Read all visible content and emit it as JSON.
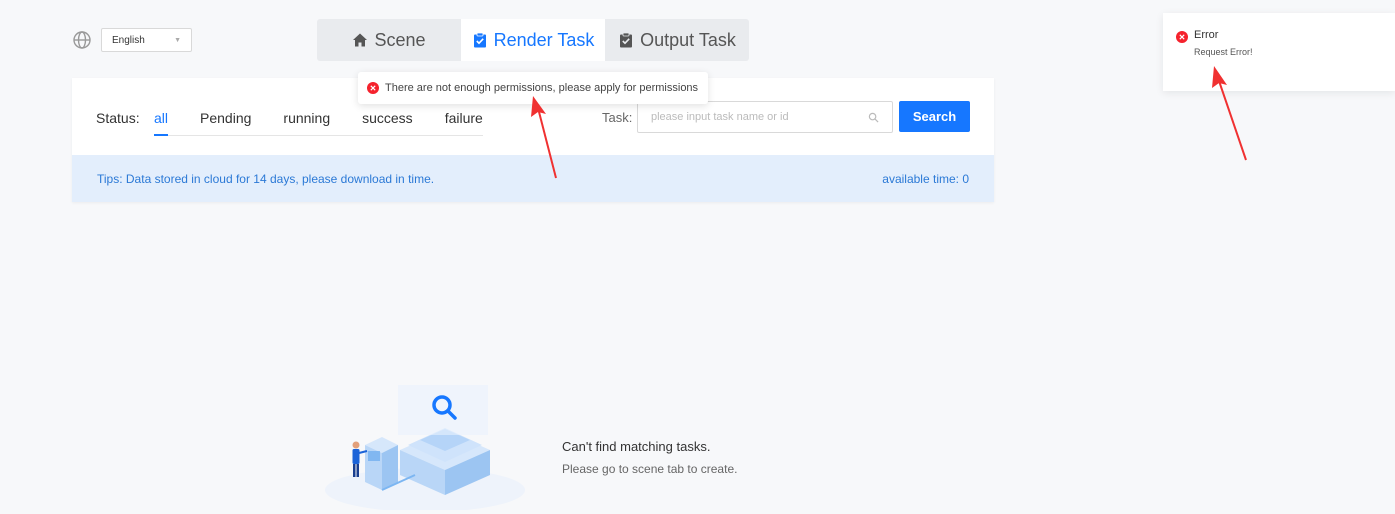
{
  "language": {
    "selected": "English"
  },
  "tabs": [
    {
      "label": "Scene",
      "icon": "home-icon"
    },
    {
      "label": "Render Task",
      "icon": "clipboard-check-icon"
    },
    {
      "label": "Output Task",
      "icon": "clipboard-icon"
    }
  ],
  "filter": {
    "status_label": "Status:",
    "statuses": [
      "all",
      "Pending",
      "running",
      "success",
      "failure"
    ],
    "active_status": "all",
    "task_label": "Task:",
    "task_placeholder": "please input task name or id",
    "search_label": "Search"
  },
  "tips": {
    "text": "Tips: Data stored in cloud for 14 days, please download in time.",
    "available_time": "available time: 0"
  },
  "permission_message": "There are not enough permissions, please apply for permissions",
  "notification": {
    "title": "Error",
    "description": "Request Error!"
  },
  "empty_state": {
    "title": "Can't find matching tasks.",
    "subtitle": "Please go to scene tab to create."
  },
  "colors": {
    "accent": "#1677ff",
    "error": "#f5222d",
    "annotation": "#f03131",
    "tips_bg": "#e3eefc"
  }
}
